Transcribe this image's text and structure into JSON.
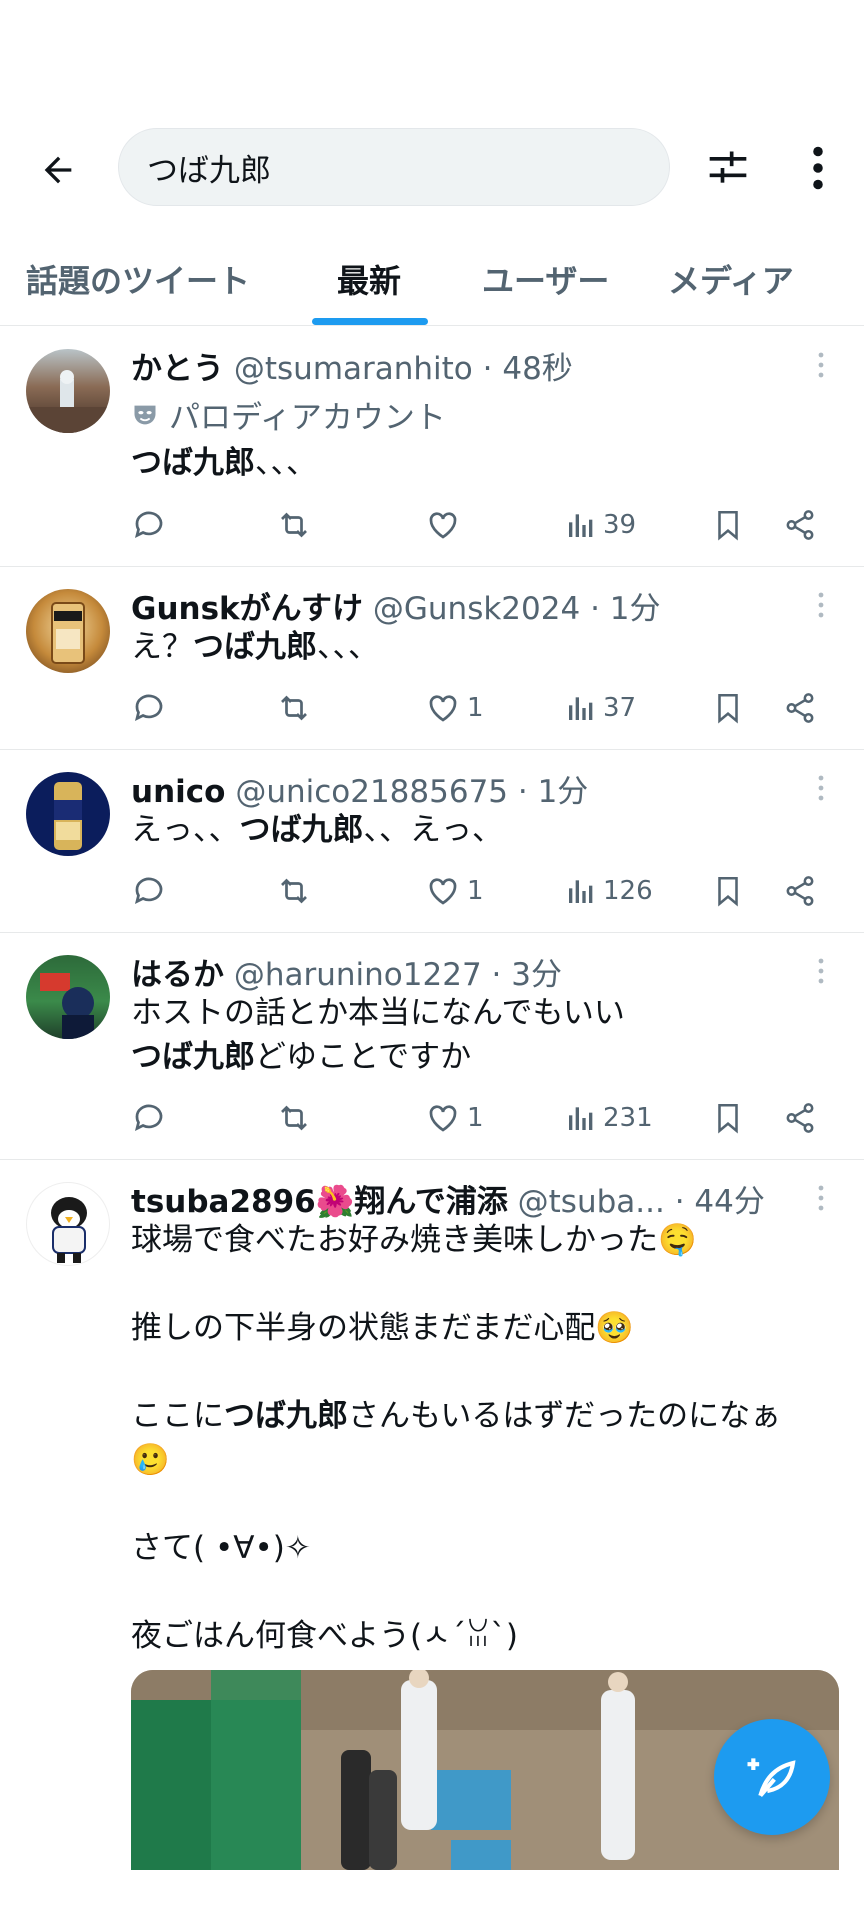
{
  "search": {
    "query": "つば九郎"
  },
  "tabs": [
    {
      "label": "話題のツイート",
      "active": false
    },
    {
      "label": "最新",
      "active": true
    },
    {
      "label": "ユーザー",
      "active": false
    },
    {
      "label": "メディア",
      "active": false
    }
  ],
  "colors": {
    "accent": "#1d9bf0",
    "text": "#0f1419",
    "muted": "#536471"
  },
  "tweets": [
    {
      "name": "かとう",
      "handle": "@tsumaranhito",
      "time": "· 48秒",
      "badge": "パロディアカウント",
      "body_bold": "つば九郎",
      "body_after": "、、、",
      "views": "39",
      "likes": ""
    },
    {
      "name": "Gunskがんすけ",
      "handle": "@Gunsk2024",
      "time": "· 1分",
      "body_before": "え？",
      "body_bold": "つば九郎",
      "body_after": "、、、",
      "likes": "1",
      "views": "37"
    },
    {
      "name": "unico",
      "handle": "@unico21885675",
      "time": "· 1分",
      "body_before": "えっ、、",
      "body_bold": "つば九郎",
      "body_after": "、、えっ、",
      "likes": "1",
      "views": "126"
    },
    {
      "name": "はるか",
      "handle": "@harunino1227",
      "time": "· 3分",
      "body_line1": "ホストの話とか本当になんでもいい",
      "body_bold": "つば九郎",
      "body_after": "どゆことですか",
      "likes": "1",
      "views": "231"
    },
    {
      "name": "tsuba2896🌺翔んで浦添",
      "handle": "@tsuba...",
      "time": "· 44分",
      "line1": "球場で食べたお好み焼き美味しかった🤤",
      "line2": "推しの下半身の状態まだまだ心配🥹",
      "line3_before": "ここに",
      "line3_bold": "つば九郎",
      "line3_after": "さんもいるはずだったのになぁ",
      "line3_emoji": "🥲",
      "line4": "さて( •∀•)✧",
      "line5": "夜ごはん何食べよう(ㅅ´ꈍ`)"
    }
  ]
}
